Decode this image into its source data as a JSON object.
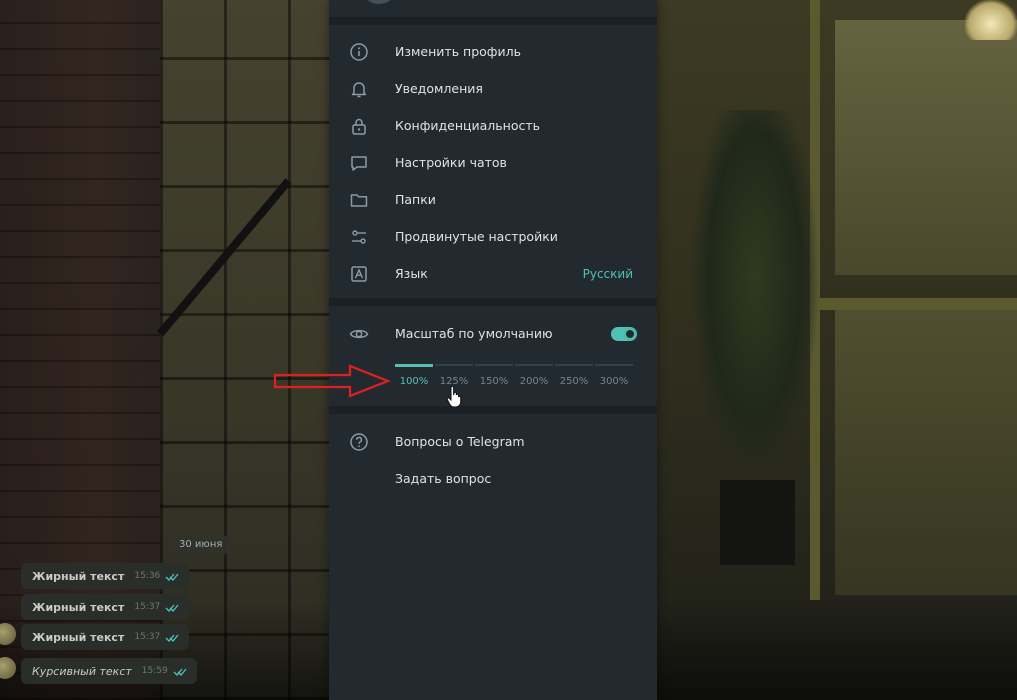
{
  "settings": {
    "items": [
      {
        "label": "Изменить профиль",
        "icon": "info-icon"
      },
      {
        "label": "Уведомления",
        "icon": "bell-icon"
      },
      {
        "label": "Конфиденциальность",
        "icon": "lock-icon"
      },
      {
        "label": "Настройки чатов",
        "icon": "chat-bubble-icon"
      },
      {
        "label": "Папки",
        "icon": "folder-icon"
      },
      {
        "label": "Продвинутые настройки",
        "icon": "sliders-icon"
      },
      {
        "label": "Язык",
        "icon": "language-icon",
        "value": "Русский"
      }
    ],
    "scale": {
      "label": "Масштаб по умолчанию",
      "icon": "eye-icon",
      "toggle_on": true,
      "options": [
        "100%",
        "125%",
        "150%",
        "200%",
        "250%",
        "300%"
      ],
      "selected": "100%"
    },
    "help": [
      {
        "label": "Вопросы о Telegram",
        "icon": "question-icon"
      },
      {
        "label": "Задать вопрос"
      }
    ]
  },
  "chat": {
    "date": "30 июня",
    "messages": [
      {
        "text": "Жирный текст",
        "time": "15:36"
      },
      {
        "text": "Жирный текст",
        "time": "15:37"
      },
      {
        "text": "Жирный текст",
        "time": "15:37"
      },
      {
        "text": "Курсивный текст",
        "time": "15:59"
      }
    ]
  },
  "colors": {
    "accent": "#4fc2b4",
    "panel_bg": "#222a2f",
    "separator": "#1a2025",
    "text": "#dfe3e5",
    "annotation_arrow": "#e02020"
  }
}
